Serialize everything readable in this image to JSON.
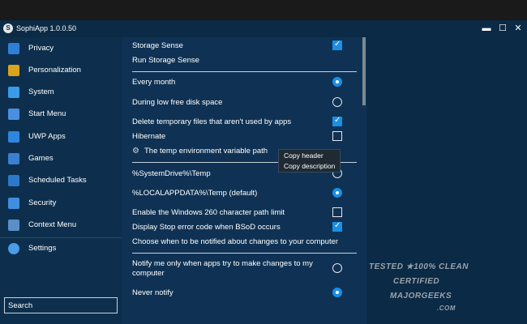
{
  "window": {
    "title": "SophiApp 1.0.0.50",
    "minimize": "▬",
    "maximize": "☐",
    "close": "✕"
  },
  "sidebar": {
    "items": [
      {
        "label": "Privacy",
        "icon": "lock-icon",
        "color": "#2f7fd6"
      },
      {
        "label": "Personalization",
        "icon": "brush-icon",
        "color": "#d9a41a"
      },
      {
        "label": "System",
        "icon": "monitor-icon",
        "color": "#3a9be8"
      },
      {
        "label": "Start Menu",
        "icon": "start-menu-icon",
        "color": "#4a8fe0"
      },
      {
        "label": "UWP Apps",
        "icon": "apps-grid-icon",
        "color": "#2e86de"
      },
      {
        "label": "Games",
        "icon": "gamepad-icon",
        "color": "#3a7fd0"
      },
      {
        "label": "Scheduled Tasks",
        "icon": "calendar-icon",
        "color": "#2b79c9"
      },
      {
        "label": "Security",
        "icon": "shield-icon",
        "color": "#3f8ee0"
      },
      {
        "label": "Context Menu",
        "icon": "context-menu-icon",
        "color": "#5a8fc8"
      }
    ],
    "settings": {
      "label": "Settings",
      "icon": "gear-icon",
      "color": "#4a9be8"
    },
    "search_placeholder": "Search"
  },
  "main": {
    "storage_sense": "Storage Sense",
    "run_storage_sense": "Run Storage Sense",
    "every_month": "Every month",
    "low_disk": "During low free disk space",
    "delete_temp": "Delete temporary files that aren't used by apps",
    "hibernate": "Hibernate",
    "temp_path_header": "The temp environment variable path",
    "systemdrive_temp": "%SystemDrive%\\Temp",
    "localappdata_temp": "%LOCALAPPDATA%\\Temp (default)",
    "path_limit": "Enable the Windows 260 character path limit",
    "stop_error": "Display Stop error code when BSoD occurs",
    "notify_header": "Choose when to be notified about changes to your computer",
    "notify_apps": "Notify me only when apps try to make changes to my computer",
    "never_notify": "Never notify",
    "states": {
      "storage_sense": true,
      "every_month": true,
      "low_disk": false,
      "delete_temp": true,
      "hibernate": false,
      "systemdrive_temp": false,
      "localappdata_temp": true,
      "path_limit": false,
      "stop_error": true,
      "notify_apps": false,
      "never_notify": true
    }
  },
  "context_menu": {
    "copy_header": "Copy header",
    "copy_description": "Copy description"
  },
  "watermark": {
    "line1": "TESTED ★100% CLEAN",
    "line2": "CERTIFIED",
    "line3": "MAJORGEEKS",
    "line4": ".COM"
  },
  "colors": {
    "accent": "#1a8fe6",
    "sidebar_bg": "#0d2f4d",
    "main_bg": "#0f3254"
  }
}
